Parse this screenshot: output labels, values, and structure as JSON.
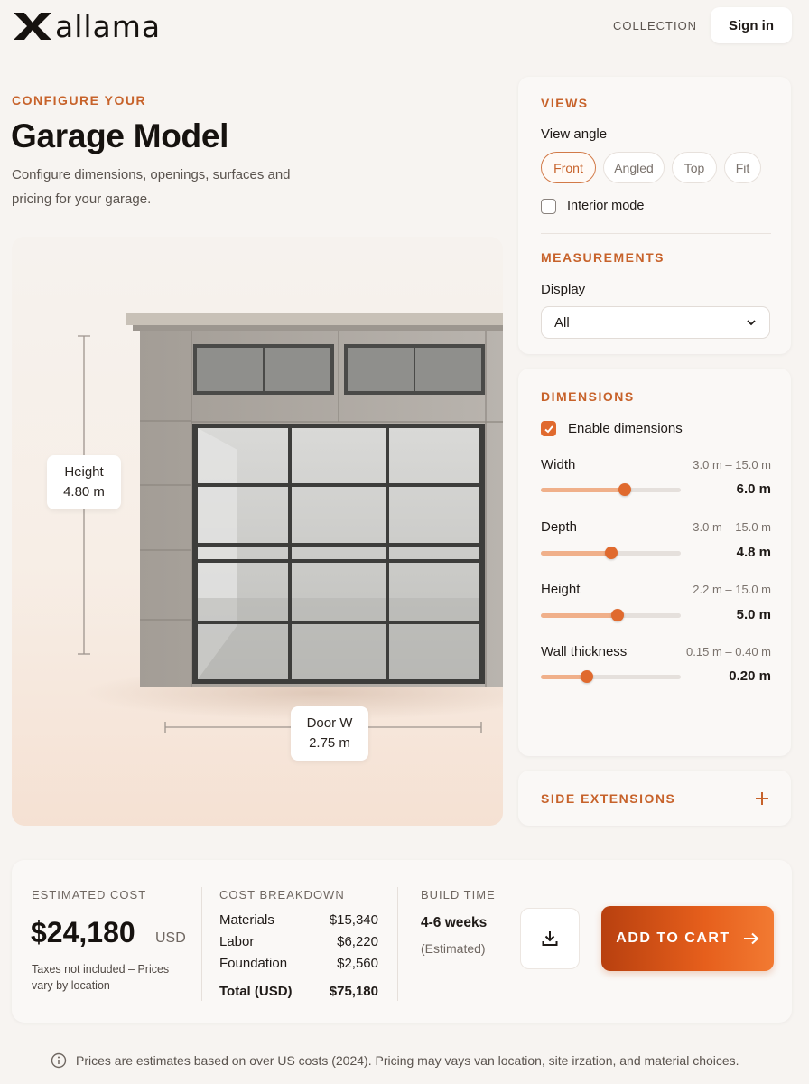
{
  "header": {
    "brand": "allama",
    "nav_collection": "COLLECTION",
    "signin": "Sign in"
  },
  "intro": {
    "eyebrow": "CONFIGURE YOUR",
    "title": "Garage Model",
    "subtitle": "Configure dimensions, openings, surfaces and pricing for your garage."
  },
  "preview": {
    "height_label": "Height",
    "height_value": "4.80 m",
    "door_label": "Door W",
    "door_value": "2.75 m"
  },
  "views": {
    "title": "VIEWS",
    "view_angle_label": "View angle",
    "options": [
      "Front",
      "Angled",
      "Top",
      "Fit"
    ],
    "selected": "Front",
    "interior_mode_label": "Interior mode",
    "interior_mode": false
  },
  "measurements": {
    "title": "MEASUREMENTS",
    "display_label": "Display",
    "display_value": "All"
  },
  "dimensions": {
    "title": "DIMENSIONS",
    "enable_label": "Enable dimensions",
    "enabled": true,
    "sliders": [
      {
        "label": "Width",
        "range": "3.0 m – 15.0 m",
        "value": "6.0 m",
        "fraction": 0.6
      },
      {
        "label": "Depth",
        "range": "3.0 m – 15.0 m",
        "value": "4.8 m",
        "fraction": 0.5
      },
      {
        "label": "Height",
        "range": "2.2 m – 15.0 m",
        "value": "5.0 m",
        "fraction": 0.55
      },
      {
        "label": "Wall thickness",
        "range": "0.15 m – 0.40 m",
        "value": "0.20 m",
        "fraction": 0.33
      }
    ]
  },
  "side_extensions": {
    "title": "SIDE EXTENSIONS"
  },
  "cost": {
    "estimated_label": "ESTIMATED COST",
    "amount": "$24,180",
    "currency": "USD",
    "note": "Taxes not included – Prices vary by location",
    "breakdown_label": "COST BREAKDOWN",
    "breakdown": [
      {
        "item": "Materials",
        "amount": "$15,340"
      },
      {
        "item": "Labor",
        "amount": "$6,220"
      },
      {
        "item": "Foundation",
        "amount": "$2,560"
      }
    ],
    "total_label": "Total (USD)",
    "total_amount": "$75,180",
    "build_time_label": "BUILD TIME",
    "build_time": "4-6 weeks",
    "build_time_note": "(Estimated)",
    "add_to_cart": "ADD TO CART"
  },
  "footnote": "Prices are estimates based on over US costs (2024). Pricing may vays van location, site irzation, and material choices.",
  "colors": {
    "accent": "#c7622a",
    "slider_thumb": "#e06a2e",
    "slider_fill": "#f0b08a",
    "cart_button": "#e65f1c"
  }
}
